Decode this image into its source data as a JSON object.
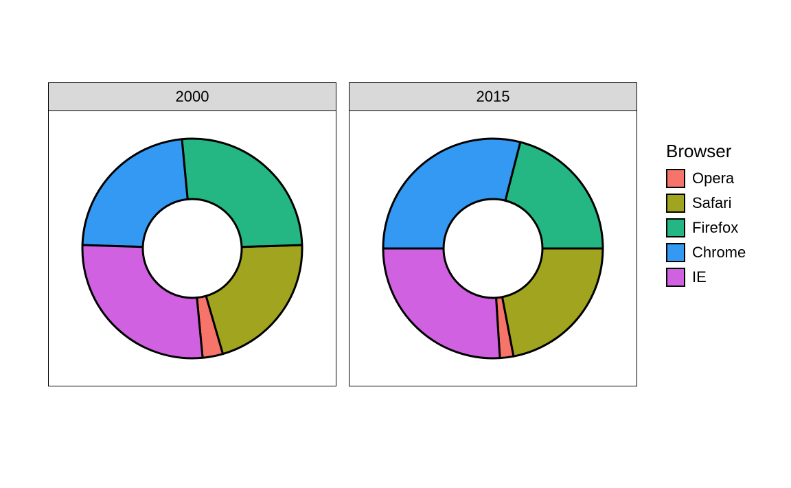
{
  "legend": {
    "title": "Browser",
    "items": [
      {
        "name": "Opera",
        "color": "#F7746A"
      },
      {
        "name": "Safari",
        "color": "#A1A41E"
      },
      {
        "name": "Firefox",
        "color": "#24B784"
      },
      {
        "name": "Chrome",
        "color": "#3399F3"
      },
      {
        "name": "IE",
        "color": "#D061E0"
      }
    ]
  },
  "chart_data": [
    {
      "type": "pie",
      "title": "2000",
      "categories": [
        "Opera",
        "Safari",
        "Firefox",
        "Chrome",
        "IE"
      ],
      "values": [
        3,
        21,
        26,
        23,
        27
      ],
      "colors": [
        "#F7746A",
        "#A1A41E",
        "#24B784",
        "#3399F3",
        "#D061E0"
      ],
      "inner_radius_ratio": 0.45
    },
    {
      "type": "pie",
      "title": "2015",
      "categories": [
        "Opera",
        "Safari",
        "Firefox",
        "Chrome",
        "IE"
      ],
      "values": [
        2,
        22,
        21,
        29,
        26
      ],
      "colors": [
        "#F7746A",
        "#A1A41E",
        "#24B784",
        "#3399F3",
        "#D061E0"
      ],
      "inner_radius_ratio": 0.45
    }
  ]
}
